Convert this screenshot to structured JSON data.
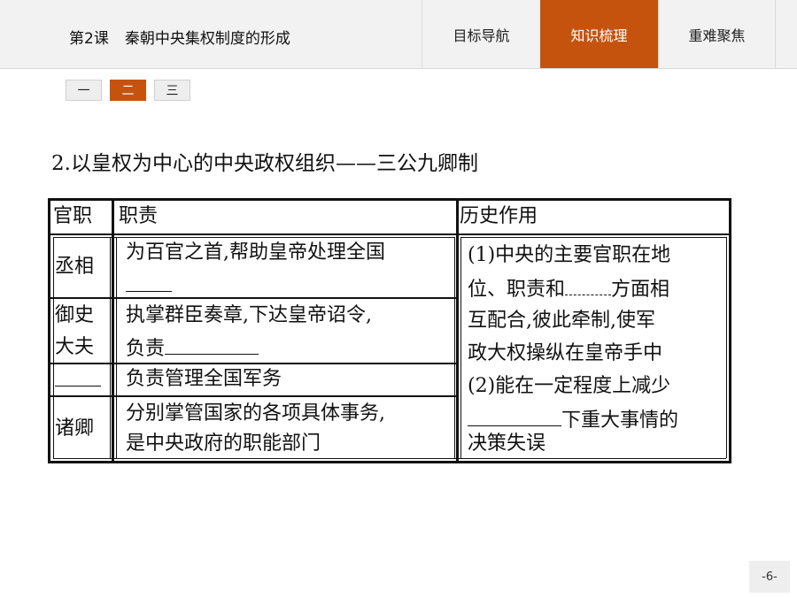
{
  "header": {
    "lesson_number": "第2课",
    "lesson_title": "秦朝中央集权制度的形成",
    "tabs": [
      "目标导航",
      "知识梳理",
      "重难聚焦"
    ],
    "active_tab": "知识梳理",
    "accent_color": "#c6530d"
  },
  "sections": [
    "一",
    "二",
    "三"
  ],
  "active_section": "二",
  "heading": "2.以皇权为中心的中央政权组织——三公九卿制",
  "table": {
    "headers": [
      "官职",
      "职责",
      "历史作用"
    ],
    "rows": [
      {
        "post": "丞相",
        "duty_line1": "为百官之首,帮助皇帝处理全国",
        "duty_line2": ""
      },
      {
        "post_line1": "御史",
        "post_line2": "大夫",
        "duty_line1": "执掌群臣奏章,下达皇帝诏令,",
        "duty_line2": "负责"
      },
      {
        "post": "",
        "duty_line1": "负责管理全国军务"
      },
      {
        "post": "诸卿",
        "duty_line1": "分别掌管国家的各项具体事务,",
        "duty_line2": "是中央政府的职能部门"
      }
    ],
    "role_lines": [
      "(1)中央的主要官职在地",
      "位、职责和",
      "方面相",
      "互配合,彼此牵制,使军",
      "政大权操纵在皇帝手中",
      "(2)能在一定程度上减少",
      "下重大事情的",
      "决策失误"
    ]
  },
  "page_number": "-6-"
}
